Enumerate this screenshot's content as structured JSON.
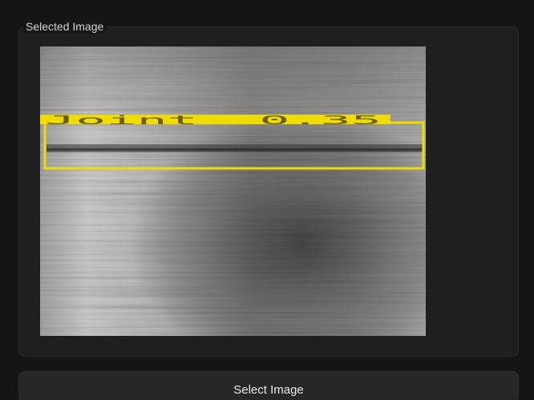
{
  "group": {
    "title": "Selected Image"
  },
  "image": {
    "description_icon": "grayscale-scan-image",
    "detection": {
      "label": "Joint",
      "score": "0.35",
      "label_text": "Joint  0.35",
      "color": "#f0dc00"
    }
  },
  "button": {
    "label": "Select Image"
  },
  "colors": {
    "background": "#151515",
    "panel": "#1f1f1f",
    "button": "#272727",
    "text": "#ececec",
    "box": "#f0dc00"
  }
}
